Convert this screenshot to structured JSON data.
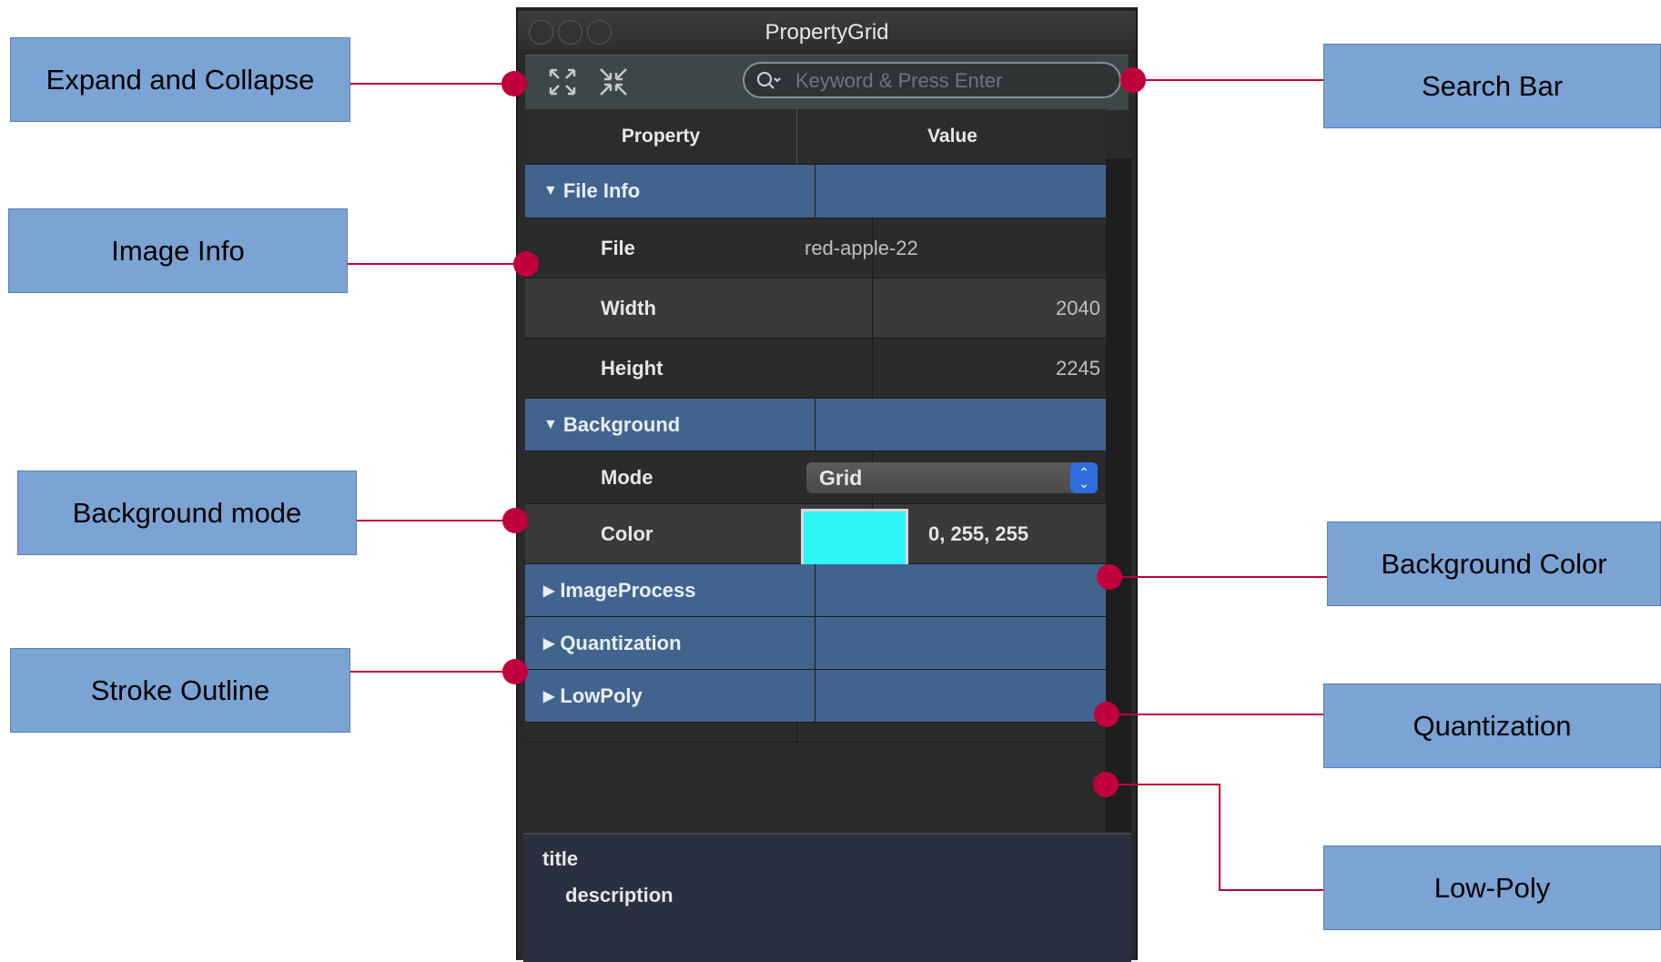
{
  "window": {
    "title": "PropertyGrid"
  },
  "toolbar": {
    "expand_icon": "expand-arrows-icon",
    "collapse_icon": "collapse-arrows-icon",
    "search_placeholder": "Keyword & Press Enter"
  },
  "grid": {
    "header": {
      "property": "Property",
      "value": "Value"
    },
    "file_info": {
      "label": "File Info",
      "file": {
        "name": "File",
        "value": "red-apple-22"
      },
      "width": {
        "name": "Width",
        "value": "2040"
      },
      "height": {
        "name": "Height",
        "value": "2245"
      }
    },
    "background": {
      "label": "Background",
      "mode": {
        "name": "Mode",
        "value": "Grid"
      },
      "color": {
        "name": "Color",
        "value": "0, 255, 255",
        "swatch": "#2ef6f6"
      }
    },
    "image_process": {
      "label": "ImageProcess"
    },
    "quantization": {
      "label": "Quantization"
    },
    "lowpoly": {
      "label": "LowPoly"
    }
  },
  "description": {
    "title": "title",
    "text": "description"
  },
  "callouts": {
    "expand_collapse": "Expand and Collapse",
    "image_info": "Image Info",
    "background_mode": "Background mode",
    "stroke_outline": "Stroke Outline",
    "search_bar": "Search Bar",
    "background_color": "Background Color",
    "quantization": "Quantization",
    "low_poly": "Low-Poly"
  },
  "colors": {
    "callout_fill": "#7ba3d4",
    "connector": "#c0003c",
    "category_row": "#41648f"
  }
}
